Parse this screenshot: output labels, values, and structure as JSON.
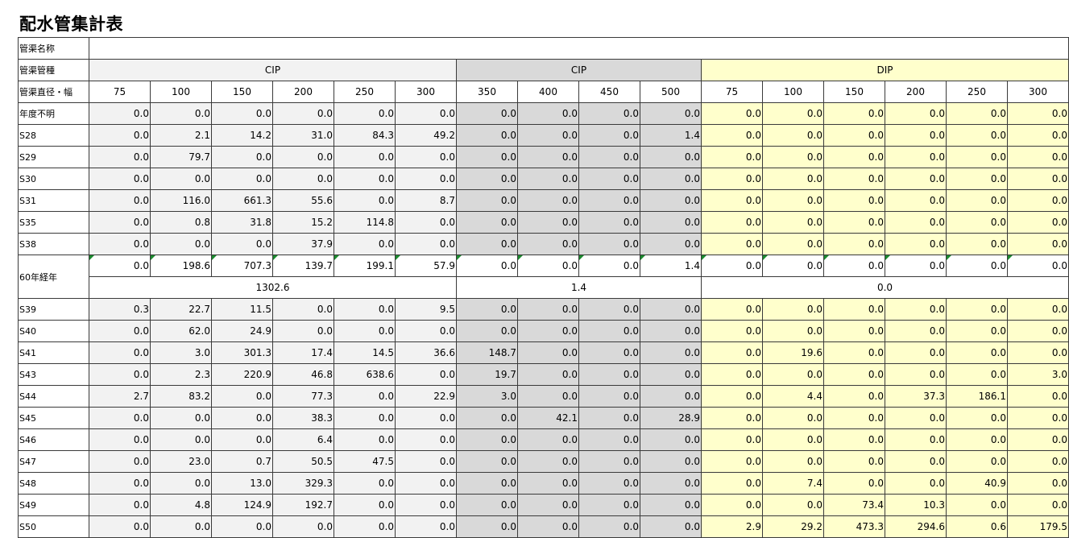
{
  "title": "配水管集計表",
  "labels": {
    "pipe_name": "管渠名称",
    "pipe_type": "管渠管種",
    "diameter": "管渠直径・幅"
  },
  "groups": [
    {
      "name": "CIP",
      "span": 6,
      "color": "g1"
    },
    {
      "name": "CIP",
      "span": 4,
      "color": "g2"
    },
    {
      "name": "DIP",
      "span": 6,
      "color": "g3"
    }
  ],
  "diameters": [
    "75",
    "100",
    "150",
    "200",
    "250",
    "300",
    "350",
    "400",
    "450",
    "500",
    "75",
    "100",
    "150",
    "200",
    "250",
    "300"
  ],
  "rows_before": [
    {
      "label": "年度不明",
      "values": [
        "0.0",
        "0.0",
        "0.0",
        "0.0",
        "0.0",
        "0.0",
        "0.0",
        "0.0",
        "0.0",
        "0.0",
        "0.0",
        "0.0",
        "0.0",
        "0.0",
        "0.0",
        "0.0"
      ]
    },
    {
      "label": "S28",
      "values": [
        "0.0",
        "2.1",
        "14.2",
        "31.0",
        "84.3",
        "49.2",
        "0.0",
        "0.0",
        "0.0",
        "1.4",
        "0.0",
        "0.0",
        "0.0",
        "0.0",
        "0.0",
        "0.0"
      ]
    },
    {
      "label": "S29",
      "values": [
        "0.0",
        "79.7",
        "0.0",
        "0.0",
        "0.0",
        "0.0",
        "0.0",
        "0.0",
        "0.0",
        "0.0",
        "0.0",
        "0.0",
        "0.0",
        "0.0",
        "0.0",
        "0.0"
      ]
    },
    {
      "label": "S30",
      "values": [
        "0.0",
        "0.0",
        "0.0",
        "0.0",
        "0.0",
        "0.0",
        "0.0",
        "0.0",
        "0.0",
        "0.0",
        "0.0",
        "0.0",
        "0.0",
        "0.0",
        "0.0",
        "0.0"
      ]
    },
    {
      "label": "S31",
      "values": [
        "0.0",
        "116.0",
        "661.3",
        "55.6",
        "0.0",
        "8.7",
        "0.0",
        "0.0",
        "0.0",
        "0.0",
        "0.0",
        "0.0",
        "0.0",
        "0.0",
        "0.0",
        "0.0"
      ]
    },
    {
      "label": "S35",
      "values": [
        "0.0",
        "0.8",
        "31.8",
        "15.2",
        "114.8",
        "0.0",
        "0.0",
        "0.0",
        "0.0",
        "0.0",
        "0.0",
        "0.0",
        "0.0",
        "0.0",
        "0.0",
        "0.0"
      ]
    },
    {
      "label": "S38",
      "values": [
        "0.0",
        "0.0",
        "0.0",
        "37.9",
        "0.0",
        "0.0",
        "0.0",
        "0.0",
        "0.0",
        "0.0",
        "0.0",
        "0.0",
        "0.0",
        "0.0",
        "0.0",
        "0.0"
      ]
    }
  ],
  "subtotal": {
    "label": "60年経年",
    "values": [
      "0.0",
      "198.6",
      "707.3",
      "139.7",
      "199.1",
      "57.9",
      "0.0",
      "0.0",
      "0.0",
      "1.4",
      "0.0",
      "0.0",
      "0.0",
      "0.0",
      "0.0",
      "0.0"
    ],
    "group_sums": [
      "1302.6",
      "1.4",
      "0.0"
    ]
  },
  "rows_after": [
    {
      "label": "S39",
      "values": [
        "0.3",
        "22.7",
        "11.5",
        "0.0",
        "0.0",
        "9.5",
        "0.0",
        "0.0",
        "0.0",
        "0.0",
        "0.0",
        "0.0",
        "0.0",
        "0.0",
        "0.0",
        "0.0"
      ]
    },
    {
      "label": "S40",
      "values": [
        "0.0",
        "62.0",
        "24.9",
        "0.0",
        "0.0",
        "0.0",
        "0.0",
        "0.0",
        "0.0",
        "0.0",
        "0.0",
        "0.0",
        "0.0",
        "0.0",
        "0.0",
        "0.0"
      ]
    },
    {
      "label": "S41",
      "values": [
        "0.0",
        "3.0",
        "301.3",
        "17.4",
        "14.5",
        "36.6",
        "148.7",
        "0.0",
        "0.0",
        "0.0",
        "0.0",
        "19.6",
        "0.0",
        "0.0",
        "0.0",
        "0.0"
      ]
    },
    {
      "label": "S43",
      "values": [
        "0.0",
        "2.3",
        "220.9",
        "46.8",
        "638.6",
        "0.0",
        "19.7",
        "0.0",
        "0.0",
        "0.0",
        "0.0",
        "0.0",
        "0.0",
        "0.0",
        "0.0",
        "3.0"
      ]
    },
    {
      "label": "S44",
      "values": [
        "2.7",
        "83.2",
        "0.0",
        "77.3",
        "0.0",
        "22.9",
        "3.0",
        "0.0",
        "0.0",
        "0.0",
        "0.0",
        "4.4",
        "0.0",
        "37.3",
        "186.1",
        "0.0"
      ]
    },
    {
      "label": "S45",
      "values": [
        "0.0",
        "0.0",
        "0.0",
        "38.3",
        "0.0",
        "0.0",
        "0.0",
        "42.1",
        "0.0",
        "28.9",
        "0.0",
        "0.0",
        "0.0",
        "0.0",
        "0.0",
        "0.0"
      ]
    },
    {
      "label": "S46",
      "values": [
        "0.0",
        "0.0",
        "0.0",
        "6.4",
        "0.0",
        "0.0",
        "0.0",
        "0.0",
        "0.0",
        "0.0",
        "0.0",
        "0.0",
        "0.0",
        "0.0",
        "0.0",
        "0.0"
      ]
    },
    {
      "label": "S47",
      "values": [
        "0.0",
        "23.0",
        "0.7",
        "50.5",
        "47.5",
        "0.0",
        "0.0",
        "0.0",
        "0.0",
        "0.0",
        "0.0",
        "0.0",
        "0.0",
        "0.0",
        "0.0",
        "0.0"
      ]
    },
    {
      "label": "S48",
      "values": [
        "0.0",
        "0.0",
        "13.0",
        "329.3",
        "0.0",
        "0.0",
        "0.0",
        "0.0",
        "0.0",
        "0.0",
        "0.0",
        "7.4",
        "0.0",
        "0.0",
        "40.9",
        "0.0"
      ]
    },
    {
      "label": "S49",
      "values": [
        "0.0",
        "4.8",
        "124.9",
        "192.7",
        "0.0",
        "0.0",
        "0.0",
        "0.0",
        "0.0",
        "0.0",
        "0.0",
        "0.0",
        "73.4",
        "10.3",
        "0.0",
        "0.0"
      ]
    },
    {
      "label": "S50",
      "values": [
        "0.0",
        "0.0",
        "0.0",
        "0.0",
        "0.0",
        "0.0",
        "0.0",
        "0.0",
        "0.0",
        "0.0",
        "2.9",
        "29.2",
        "473.3",
        "294.6",
        "0.6",
        "179.5"
      ]
    }
  ]
}
